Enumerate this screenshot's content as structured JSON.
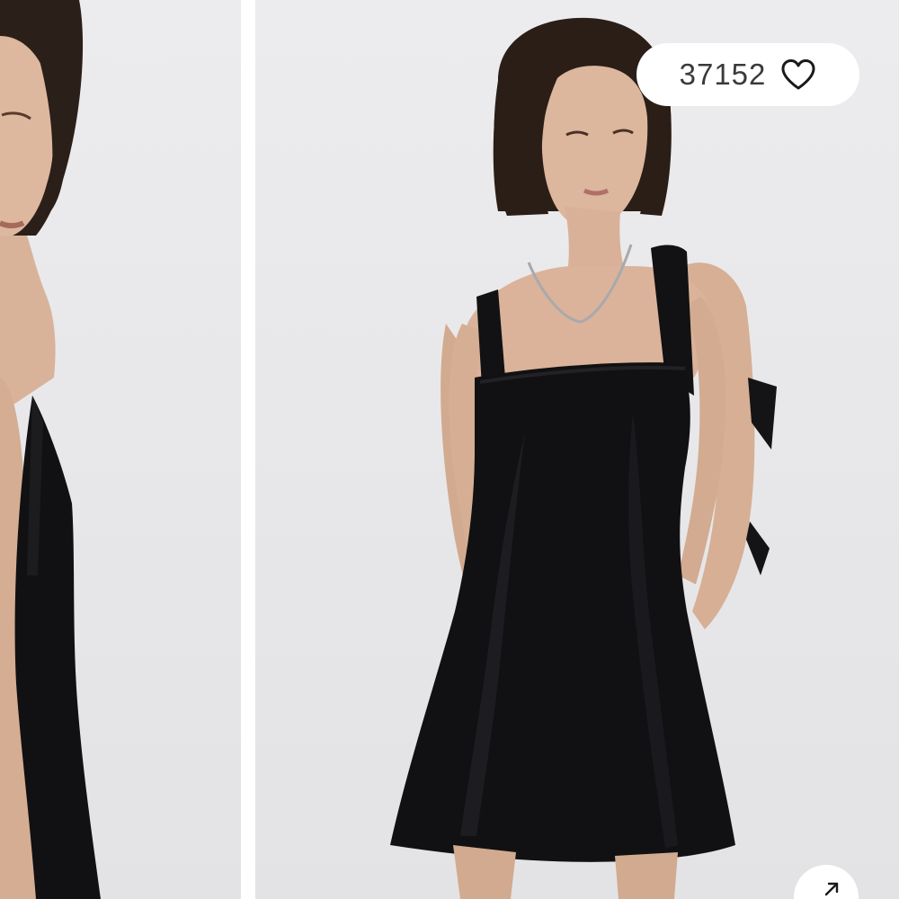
{
  "product_gallery": {
    "images": [
      {
        "alt": ""
      },
      {
        "alt": ""
      }
    ],
    "like_button": {
      "count": "37152",
      "icon": "heart-outline-icon"
    },
    "expand_button": {
      "icon": "arrow-up-right-icon"
    }
  },
  "colors": {
    "backdrop": "#e9e9eb",
    "dress": "#101012",
    "hair": "#2a1e18",
    "skin": "#d9b39a",
    "pill_bg": "#ffffff",
    "icon": "#1a1a1a"
  }
}
